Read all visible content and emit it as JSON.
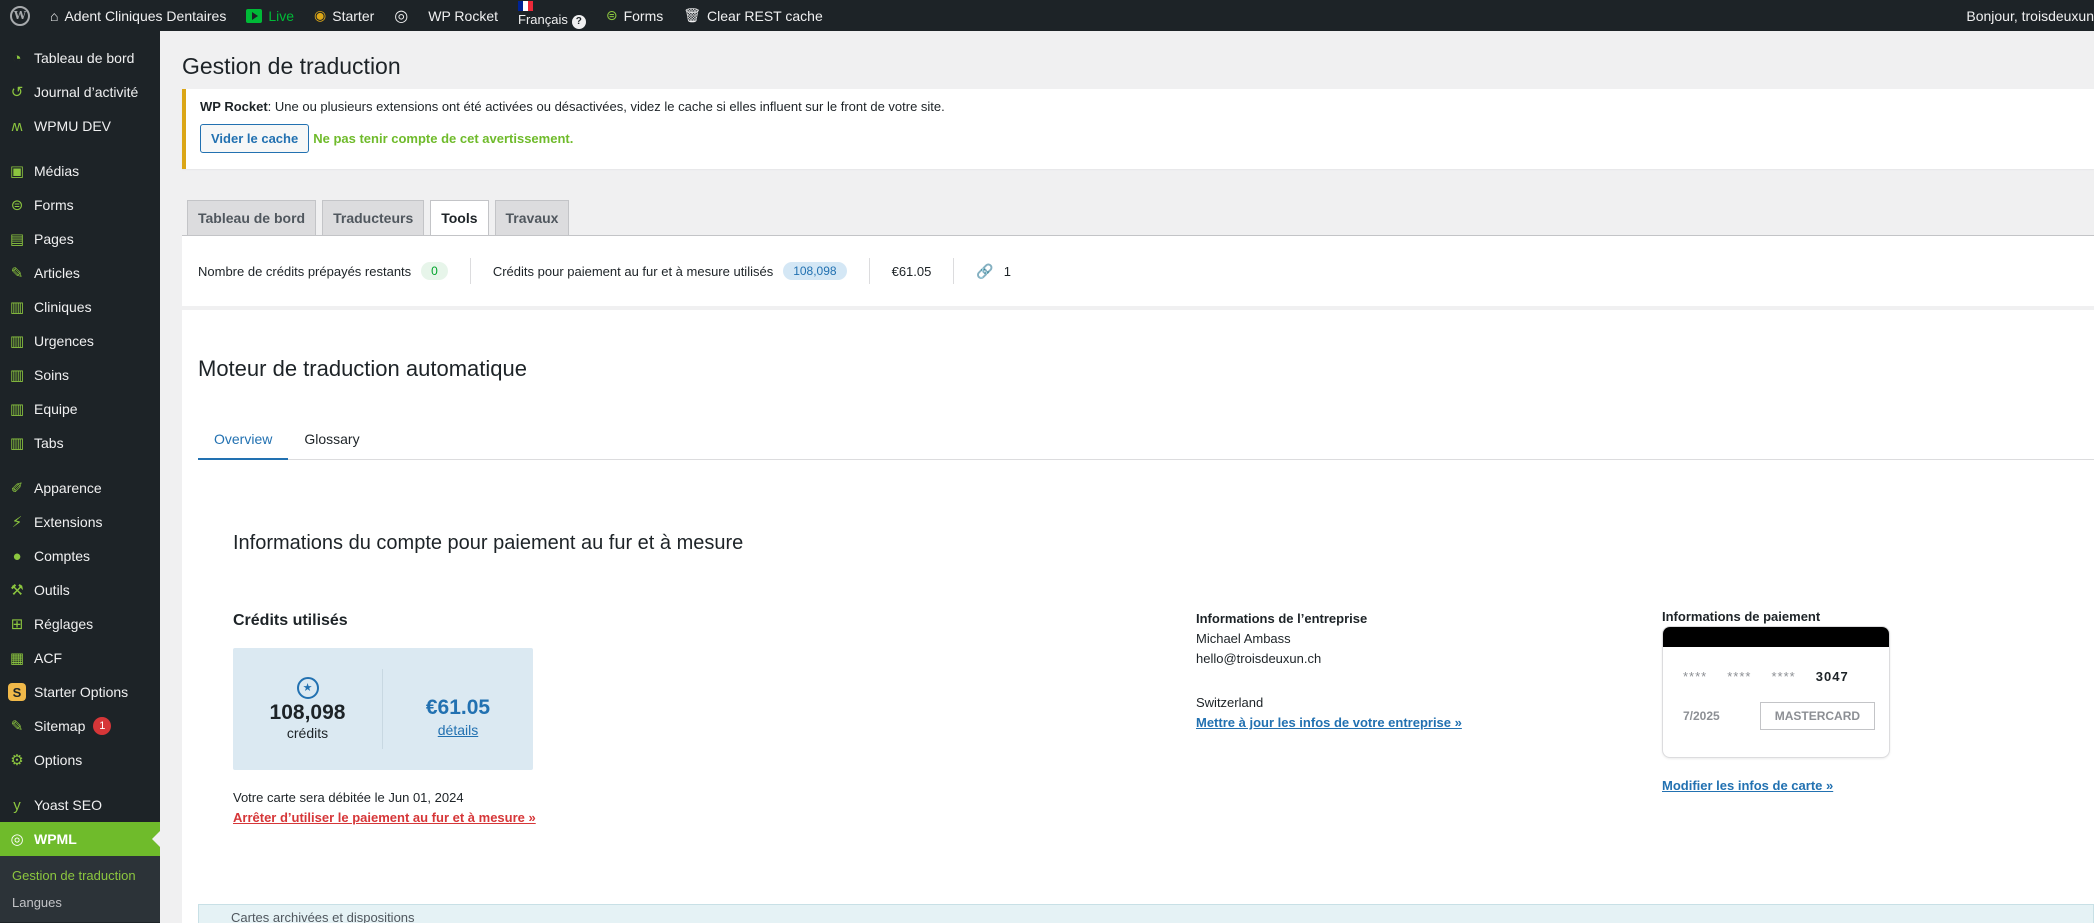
{
  "adminbar": {
    "site_name": "Adent Cliniques Dentaires",
    "live_label": "Live",
    "starter_label": "Starter",
    "wprocket_label": "WP Rocket",
    "language_label": "Français",
    "forms_label": "Forms",
    "clear_cache_label": "Clear REST cache",
    "greeting": "Bonjour, troisdeuxun"
  },
  "sidebar": {
    "items": [
      {
        "label": "Tableau de bord",
        "icon": "dashboard-icon"
      },
      {
        "label": "Journal d’activité",
        "icon": "history-icon"
      },
      {
        "label": "WPMU DEV",
        "icon": "wpmudev-icon"
      },
      {
        "label": "Médias",
        "icon": "media-icon"
      },
      {
        "label": "Forms",
        "icon": "forms-icon"
      },
      {
        "label": "Pages",
        "icon": "pages-icon"
      },
      {
        "label": "Articles",
        "icon": "pin-icon"
      },
      {
        "label": "Cliniques",
        "icon": "table-icon"
      },
      {
        "label": "Urgences",
        "icon": "table-icon"
      },
      {
        "label": "Soins",
        "icon": "table-icon"
      },
      {
        "label": "Equipe",
        "icon": "table-icon"
      },
      {
        "label": "Tabs",
        "icon": "table-icon"
      },
      {
        "label": "Apparence",
        "icon": "brush-icon"
      },
      {
        "label": "Extensions",
        "icon": "plugin-icon"
      },
      {
        "label": "Comptes",
        "icon": "user-icon"
      },
      {
        "label": "Outils",
        "icon": "wrench-icon"
      },
      {
        "label": "Réglages",
        "icon": "settings-icon"
      },
      {
        "label": "ACF",
        "icon": "acf-icon"
      },
      {
        "label": "Starter Options",
        "icon": "starter-s-icon"
      },
      {
        "label": "Sitemap",
        "icon": "sitemap-icon",
        "badge": "1"
      },
      {
        "label": "Options",
        "icon": "gear-icon"
      },
      {
        "label": "Yoast SEO",
        "icon": "yoast-icon"
      },
      {
        "label": "WPML",
        "icon": "wpml-icon"
      }
    ],
    "submenu": [
      "Gestion de traduction",
      "Langues"
    ]
  },
  "page": {
    "title": "Gestion de traduction",
    "notice": {
      "brand": "WP Rocket",
      "text": ": Une ou plusieurs extensions ont été activées ou désactivées, videz le cache si elles influent sur le front de votre site.",
      "clear_button": "Vider le cache",
      "dismiss_link": "Ne pas tenir compte de cet avertissement."
    },
    "tabs": [
      "Tableau de bord",
      "Traducteurs",
      "Tools",
      "Travaux"
    ],
    "credit_bar": {
      "prepaid_label": "Nombre de crédits prépayés restants",
      "prepaid_value": "0",
      "payg_label": "Crédits pour paiement au fur et à mesure utilisés",
      "payg_value": "108,098",
      "amount": "€61.05",
      "links_count": "1"
    },
    "engine_title": "Moteur de traduction automatique",
    "subtabs": [
      "Overview",
      "Glossary"
    ],
    "account_title": "Informations du compte pour paiement au fur et à mesure",
    "credits": {
      "label": "Crédits utilisés",
      "count": "108,098",
      "count_unit": "crédits",
      "amount": "€61.05",
      "details_link": "détails",
      "debit_text": "Votre carte sera débitée le Jun 01, 2024",
      "stop_link": "Arrêter d’utiliser le paiement au fur et à mesure »"
    },
    "company": {
      "heading": "Informations de l’entreprise",
      "name": "Michael Ambass",
      "email": "hello@troisdeuxun.ch",
      "country": "Switzerland",
      "update_link": "Mettre à jour les infos de votre entreprise »"
    },
    "payment": {
      "heading": "Informations de paiement",
      "masked": [
        "****",
        "****",
        "****"
      ],
      "last4": "3047",
      "expiry": "7/2025",
      "brand": "MASTERCARD",
      "modify_link": "Modifier les infos de carte »"
    },
    "bottom_strip": "Cartes archivées et dispositions"
  }
}
